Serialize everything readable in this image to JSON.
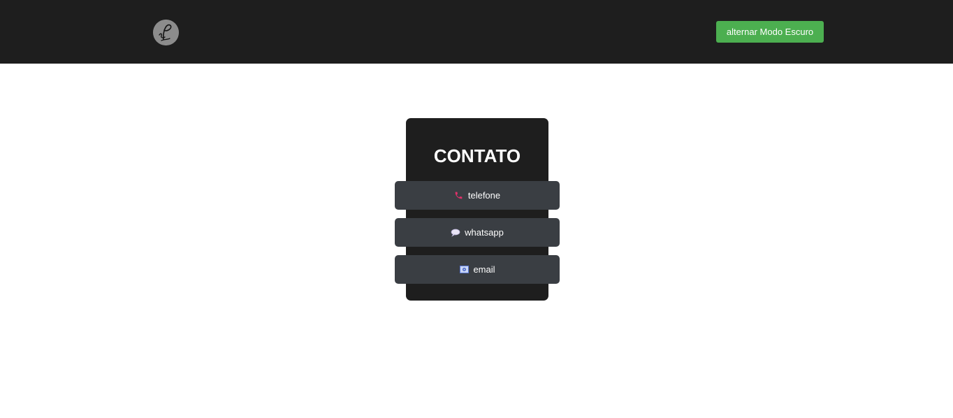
{
  "header": {
    "logo_icon": "signature-logo-icon",
    "mode_button_label": "alternar Modo Escuro",
    "mode_button_color": "#4caf50",
    "background": "#1e1e1e"
  },
  "contact": {
    "title": "CONTATO",
    "items": [
      {
        "label": "telefone",
        "icon": "phone-icon",
        "icon_color": "#e0306a"
      },
      {
        "label": "whatsapp",
        "icon": "speech-bubble-icon",
        "icon_color": "#dcd6f0"
      },
      {
        "label": "email",
        "icon": "envelope-icon",
        "icon_color": "#5a78d6"
      }
    ]
  }
}
